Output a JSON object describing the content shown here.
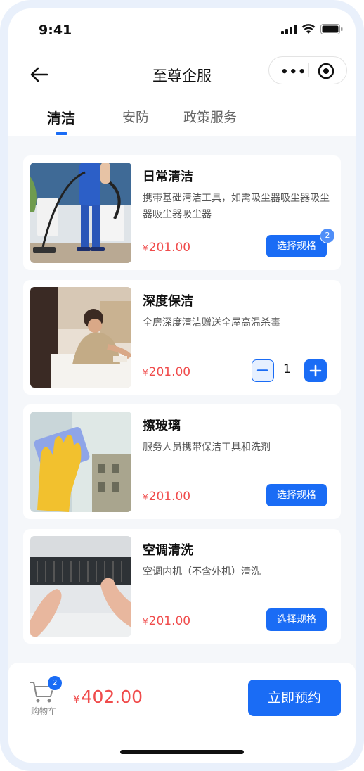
{
  "status_bar": {
    "time": "9:41"
  },
  "nav": {
    "title": "至尊企服",
    "more_label": "•••"
  },
  "tabs": [
    {
      "label": "清洁",
      "active": true
    },
    {
      "label": "安防",
      "active": false
    },
    {
      "label": "政策服务",
      "active": false
    }
  ],
  "services": [
    {
      "name": "日常清洁",
      "desc": "携带基础清洁工具，如需吸尘器吸尘器吸尘器吸尘器吸尘器",
      "currency": "¥",
      "price": "201.00",
      "action": "选择规格",
      "badge": "2"
    },
    {
      "name": "深度保洁",
      "desc": "全房深度清洁赠送全屋高温杀毒",
      "currency": "¥",
      "price": "201.00",
      "quantity": "1"
    },
    {
      "name": "擦玻璃",
      "desc": "服务人员携带保洁工具和洗剂",
      "currency": "¥",
      "price": "201.00",
      "action": "选择规格"
    },
    {
      "name": "空调清洗",
      "desc": "空调内机（不含外机）清洗",
      "currency": "¥",
      "price": "201.00",
      "action": "选择规格"
    }
  ],
  "cart": {
    "label": "购物车",
    "count": "2",
    "currency": "¥",
    "total": "402.00"
  },
  "book_label": "立即预约",
  "colors": {
    "accent": "#1a6cf5",
    "price": "#f04c4c",
    "background": "#f5f7fa"
  }
}
